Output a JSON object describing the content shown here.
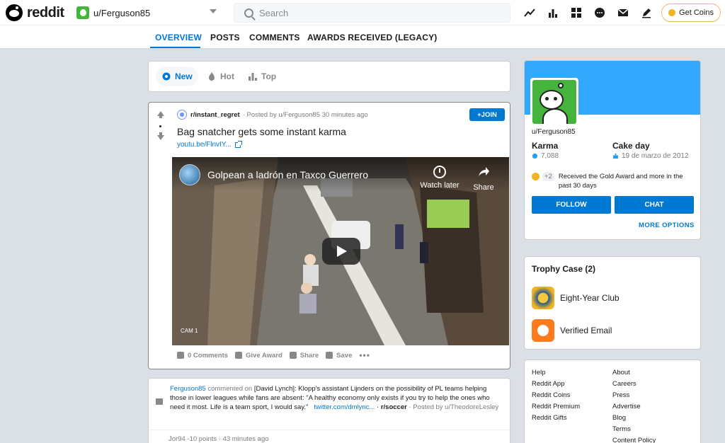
{
  "header": {
    "logo_text": "reddit",
    "user_label": "u/Ferguson85",
    "search_placeholder": "Search",
    "get_coins": "Get Coins"
  },
  "tabs": {
    "overview": "OVERVIEW",
    "posts": "POSTS",
    "comments": "COMMENTS",
    "awards": "AWARDS RECEIVED (LEGACY)"
  },
  "sort": {
    "new": "New",
    "hot": "Hot",
    "top": "Top"
  },
  "post": {
    "subreddit": "r/instant_regret",
    "meta": "· Posted by u/Ferguson85 30 minutes ago",
    "join": "+JOIN",
    "title": "Bag snatcher gets some instant karma",
    "link": "youtu.be/FlnvIY...",
    "video_title": "Golpean a ladrón en Taxco Guerrero",
    "watch_later": "Watch later",
    "share_vid": "Share",
    "cam_label": "CAM 1",
    "comments": "0 Comments",
    "give_award": "Give Award",
    "share": "Share",
    "save": "Save",
    "more": "•••"
  },
  "comment": {
    "user": "Ferguson85",
    "verb": " commented on ",
    "title": "[David Lynch]: Klopp's assistant Lijnders on the possibility of PL teams helping those in lower leagues while fans are absent: \"A healthy economy only exists if you try to help the ones who need it most. Life is a team sport, I would say.\"",
    "link": "twitter.com/dmlync...",
    "sub": "r/soccer",
    "posted_by": " · Posted by u/TheodoreLesley",
    "reply": "Jor94 -10 points · 43 minutes ago"
  },
  "profile": {
    "username": "u/Ferguson85",
    "karma_label": "Karma",
    "karma_value": "7,088",
    "cakeday_label": "Cake day",
    "cakeday_value": "19 de marzo de 2012",
    "award_plus": "+2",
    "award_text": "Received the Gold Award and more in the past 30 days",
    "follow": "FOLLOW",
    "chat": "CHAT",
    "more_options": "MORE OPTIONS"
  },
  "trophy": {
    "title": "Trophy Case (2)",
    "items": [
      "Eight-Year Club",
      "Verified Email"
    ]
  },
  "footer": {
    "left": [
      "Help",
      "Reddit App",
      "Reddit Coins",
      "Reddit Premium",
      "Reddit Gifts"
    ],
    "right": [
      "About",
      "Careers",
      "Press",
      "Advertise",
      "Blog",
      "Terms",
      "Content Policy"
    ]
  },
  "colors": {
    "accent": "#0079d3",
    "banner": "#33a8ff",
    "avatar_green": "#46b33c"
  }
}
